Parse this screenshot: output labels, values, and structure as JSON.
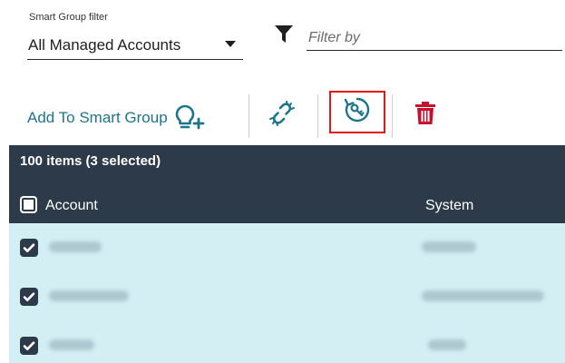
{
  "filter": {
    "smart_group_caption": "Smart Group filter",
    "smart_group_value": "All Managed Accounts",
    "filter_placeholder": "Filter by"
  },
  "toolbar": {
    "add_to_smart_group_label": "Add To Smart Group",
    "icons": [
      "add-bulb-icon",
      "unlink-icon",
      "rotate-password-icon",
      "trash-icon"
    ],
    "accent_color": "#1c7589",
    "delete_color": "#c8102e",
    "highlight_color": "#e8161b"
  },
  "grid": {
    "count_label": "100 items (3 selected)",
    "columns": {
      "account": "Account",
      "system": "System"
    },
    "header_color": "#2c3a4a",
    "row_color": "#d4eff4",
    "rows": [
      {
        "selected": true,
        "account": "",
        "system": ""
      },
      {
        "selected": true,
        "account": "",
        "system": ""
      },
      {
        "selected": true,
        "account": "",
        "system": ""
      }
    ]
  }
}
